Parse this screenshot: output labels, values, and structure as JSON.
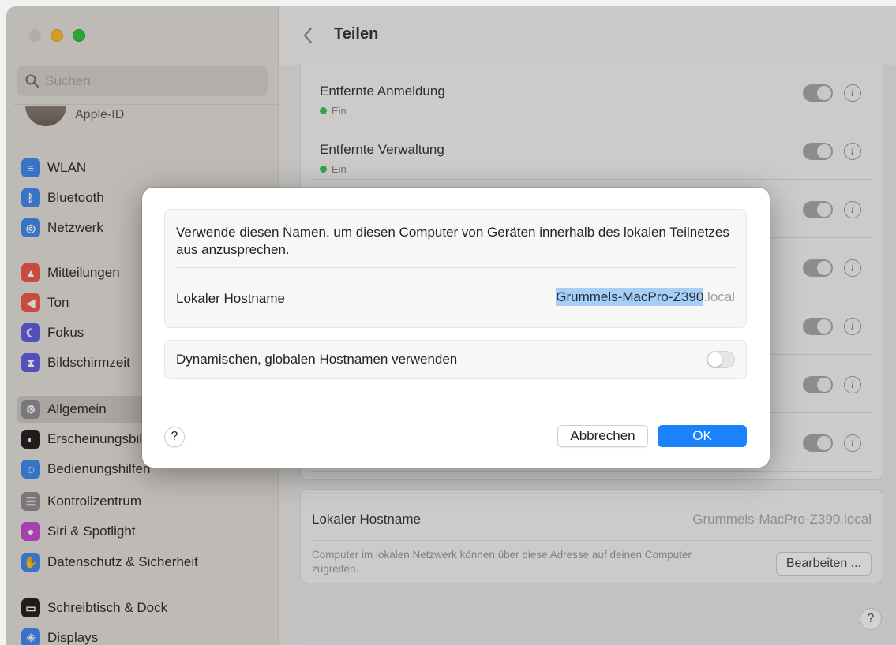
{
  "window": {
    "title": "Teilen"
  },
  "sidebar": {
    "search_placeholder": "Suchen",
    "apple_id_label": "Apple-ID",
    "items": [
      {
        "label": "WLAN",
        "icon": "wifi-icon",
        "color": "#3b8af5"
      },
      {
        "label": "Bluetooth",
        "icon": "bluetooth-icon",
        "color": "#3b8af5"
      },
      {
        "label": "Netzwerk",
        "icon": "globe-icon",
        "color": "#3b8af5"
      },
      {
        "label": "Mitteilungen",
        "icon": "bell-icon",
        "color": "#f2564a"
      },
      {
        "label": "Ton",
        "icon": "speaker-icon",
        "color": "#f2564a"
      },
      {
        "label": "Fokus",
        "icon": "moon-icon",
        "color": "#5e5ce6"
      },
      {
        "label": "Bildschirmzeit",
        "icon": "hourglass-icon",
        "color": "#5e5ce6"
      },
      {
        "label": "Allgemein",
        "icon": "gear-icon",
        "color": "#8e8e93",
        "selected": true
      },
      {
        "label": "Erscheinungsbild",
        "icon": "appearance-icon",
        "color": "#1c1c1e"
      },
      {
        "label": "Bedienungshilfen",
        "icon": "accessibility-icon",
        "color": "#3b8af5"
      },
      {
        "label": "Kontrollzentrum",
        "icon": "toggles-icon",
        "color": "#8e8e93"
      },
      {
        "label": "Siri & Spotlight",
        "icon": "siri-icon",
        "color": "#c848d8"
      },
      {
        "label": "Datenschutz & Sicherheit",
        "icon": "hand-icon",
        "color": "#3b8af5"
      },
      {
        "label": "Schreibtisch & Dock",
        "icon": "dock-icon",
        "color": "#1c1c1e"
      },
      {
        "label": "Displays",
        "icon": "sun-icon",
        "color": "#3b8af5"
      }
    ]
  },
  "main": {
    "services": [
      {
        "title": "Entfernte Anmeldung",
        "status": "Ein"
      },
      {
        "title": "Entfernte Verwaltung",
        "status": "Ein"
      },
      {
        "title": "",
        "status": ""
      },
      {
        "title": "",
        "status": ""
      },
      {
        "title": "",
        "status": ""
      },
      {
        "title": "",
        "status": ""
      },
      {
        "title": "",
        "status": ""
      }
    ],
    "host_card": {
      "label": "Lokaler Hostname",
      "value": "Grummels-MacPro-Z390.local",
      "description": "Computer im lokalen Netzwerk können über diese Adresse auf deinen Computer zugreifen.",
      "edit_button": "Bearbeiten ..."
    },
    "help_label": "?"
  },
  "dialog": {
    "description": "Verwende diesen Namen, um diesen Computer von Geräten innerhalb des lokalen Teilnetzes aus anzusprechen.",
    "host_label": "Lokaler Hostname",
    "host_name": "Grummels-MacPro-Z390",
    "host_suffix": ".local",
    "dynamic_label": "Dynamischen, globalen Hostnamen verwenden",
    "dynamic_enabled": false,
    "help_label": "?",
    "cancel_label": "Abbrechen",
    "ok_label": "OK",
    "accent_color": "#1a82fb"
  }
}
